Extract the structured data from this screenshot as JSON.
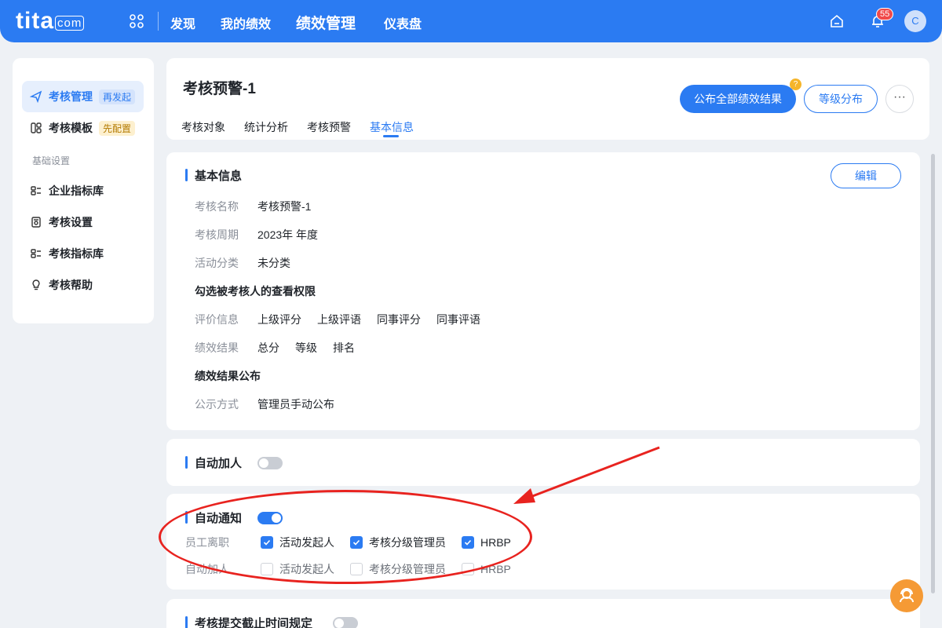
{
  "nav": {
    "logo": "tita",
    "logo_suffix": "com",
    "items": [
      "发现",
      "我的绩效",
      "绩效管理",
      "仪表盘"
    ],
    "notification_count": "55",
    "avatar_initial": "C"
  },
  "sidebar": {
    "items": [
      {
        "label": "考核管理",
        "tag": "再发起",
        "icon": "send-icon"
      },
      {
        "label": "考核模板",
        "tag": "先配置",
        "icon": "template-icon"
      }
    ],
    "group_label": "基础设置",
    "settings_items": [
      {
        "label": "企业指标库",
        "icon": "indicator-icon"
      },
      {
        "label": "考核设置",
        "icon": "settings-doc-icon"
      },
      {
        "label": "考核指标库",
        "icon": "indicator-icon"
      },
      {
        "label": "考核帮助",
        "icon": "lightbulb-icon"
      }
    ]
  },
  "header": {
    "title": "考核预警-1",
    "tabs": [
      "考核对象",
      "统计分析",
      "考核预警",
      "基本信息"
    ],
    "active_tab": "基本信息",
    "publish_button": "公布全部绩效结果",
    "help_badge": "?",
    "grade_button": "等级分布",
    "more_button": "···"
  },
  "basic_info": {
    "title": "基本信息",
    "edit_button": "编辑",
    "rows": [
      {
        "label": "考核名称",
        "values": [
          "考核预警-1"
        ]
      },
      {
        "label": "考核周期",
        "values": [
          "2023年 年度"
        ]
      },
      {
        "label": "活动分类",
        "values": [
          "未分类"
        ]
      }
    ],
    "permission_heading": "勾选被考核人的查看权限",
    "permission_rows": [
      {
        "label": "评价信息",
        "values": [
          "上级评分",
          "上级评语",
          "同事评分",
          "同事评语"
        ]
      },
      {
        "label": "绩效结果",
        "values": [
          "总分",
          "等级",
          "排名"
        ]
      }
    ],
    "publish_heading": "绩效结果公布",
    "publish_row": {
      "label": "公示方式",
      "values": [
        "管理员手动公布"
      ]
    }
  },
  "auto_add": {
    "title": "自动加人",
    "enabled": false
  },
  "auto_notify": {
    "title": "自动通知",
    "enabled": true,
    "rows": [
      {
        "label": "员工离职",
        "options": [
          {
            "text": "活动发起人",
            "checked": true
          },
          {
            "text": "考核分级管理员",
            "checked": true
          },
          {
            "text": "HRBP",
            "checked": true
          }
        ]
      },
      {
        "label": "自动加人",
        "options": [
          {
            "text": "活动发起人",
            "checked": false
          },
          {
            "text": "考核分级管理员",
            "checked": false
          },
          {
            "text": "HRBP",
            "checked": false
          }
        ]
      }
    ]
  },
  "deadline": {
    "title": "考核提交截止时间规定",
    "enabled": false
  },
  "colors": {
    "primary": "#2b7bf2",
    "annotation": "#e8231f",
    "float_button": "#f59a35"
  }
}
